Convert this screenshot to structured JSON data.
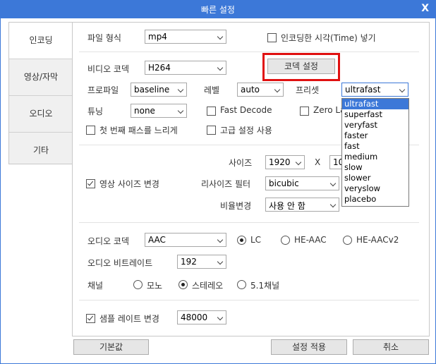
{
  "window": {
    "title": "빠른 설정",
    "close": "X"
  },
  "tabs": [
    {
      "label": "인코딩",
      "active": true
    },
    {
      "label": "영상/자막",
      "active": false
    },
    {
      "label": "오디오",
      "active": false
    },
    {
      "label": "기타",
      "active": false
    }
  ],
  "format": {
    "label": "파일 형식",
    "value": "mp4"
  },
  "insert_time": {
    "label": "인코딩한 시각(Time) 넣기",
    "checked": false
  },
  "video_codec": {
    "label": "비디오 코덱",
    "value": "H264"
  },
  "codec_settings_button": "코덱 설정",
  "profile": {
    "label": "프로파일",
    "value": "baseline"
  },
  "level": {
    "label": "레벨",
    "value": "auto"
  },
  "preset": {
    "label": "프리셋",
    "value": "ultrafast",
    "options": [
      "ultrafast",
      "superfast",
      "veryfast",
      "faster",
      "fast",
      "medium",
      "slow",
      "slower",
      "veryslow",
      "placebo"
    ]
  },
  "tune": {
    "label": "튜닝",
    "value": "none"
  },
  "fast_decode": {
    "label": "Fast Decode",
    "checked": false
  },
  "zero_latency": {
    "label": "Zero La",
    "checked": false
  },
  "slow_first_pass": {
    "label": "첫 번째 패스를 느리게",
    "checked": false
  },
  "advanced_settings": {
    "label": "고급 설정 사용",
    "checked": false
  },
  "size": {
    "label": "사이즈",
    "width": "1920",
    "x": "X",
    "height": "10"
  },
  "change_video_size": {
    "label": "영상 사이즈 변경",
    "checked": true
  },
  "resize_filter": {
    "label": "리사이즈 필터",
    "value": "bicubic"
  },
  "aspect": {
    "label": "비율변경",
    "value": "사용 안 함"
  },
  "audio_codec": {
    "label": "오디오 코덱",
    "value": "AAC"
  },
  "aac_profile": {
    "options": [
      "LC",
      "HE-AAC",
      "HE-AACv2"
    ],
    "selected": "LC"
  },
  "audio_bitrate": {
    "label": "오디오 비트레이트",
    "value": "192"
  },
  "channel": {
    "label": "채널",
    "options": [
      "모노",
      "스테레오",
      "5.1채널"
    ],
    "selected": "스테레오"
  },
  "change_sample_rate": {
    "label": "샘플 레이트 변경",
    "checked": true,
    "value": "48000"
  },
  "buttons": {
    "default": "기본값",
    "apply": "설정 적용",
    "cancel": "취소"
  },
  "colors": {
    "accent": "#3c78d8",
    "highlight": "#e01010"
  }
}
